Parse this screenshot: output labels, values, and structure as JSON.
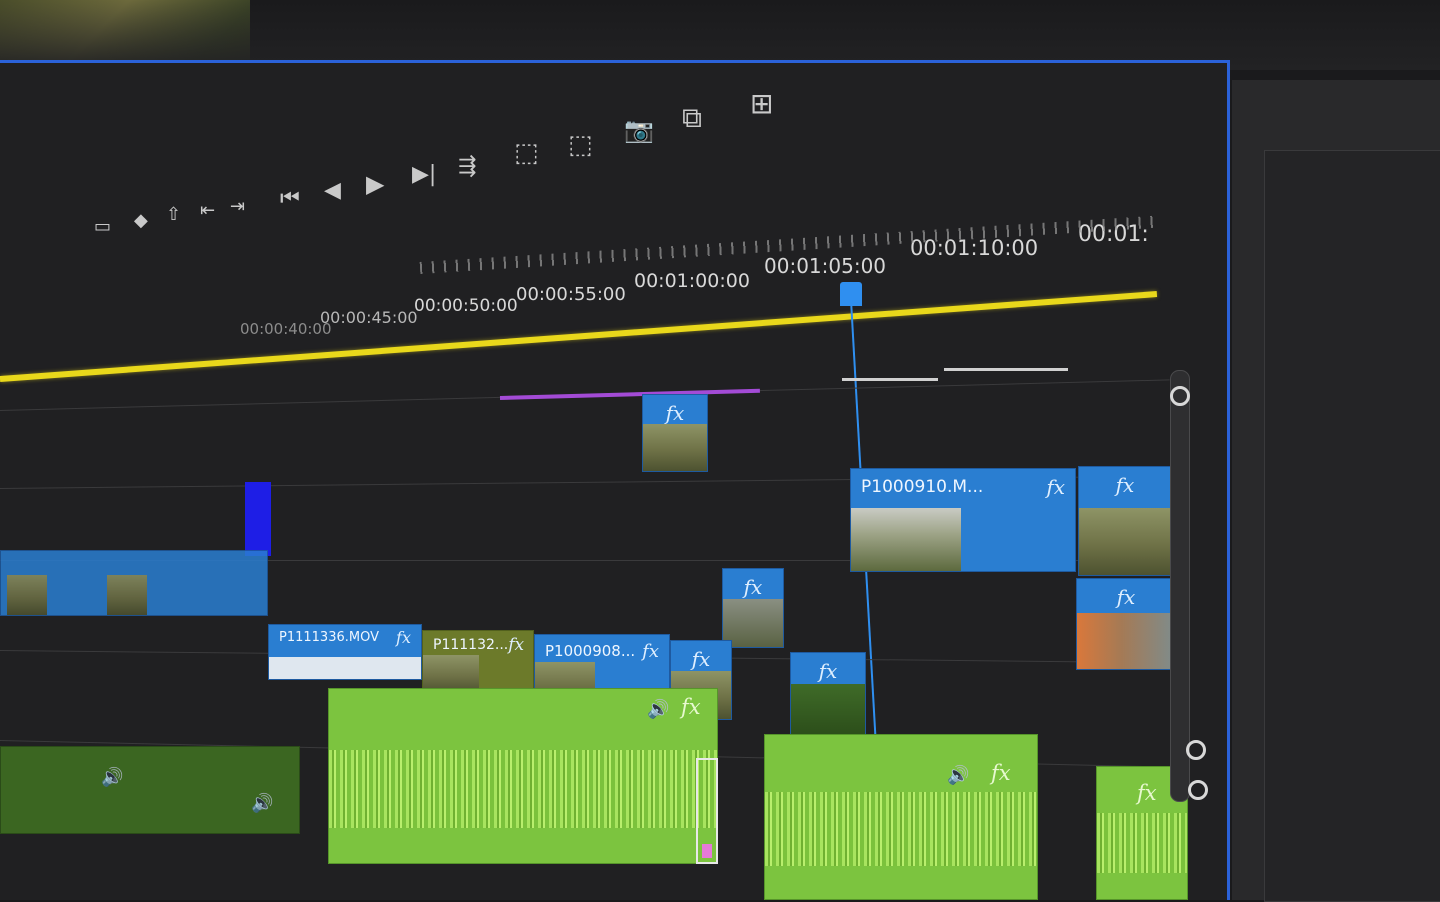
{
  "toolbar": {
    "buttons": [
      {
        "name": "mark-in-button",
        "glyph": "▭"
      },
      {
        "name": "mark-out-button",
        "glyph": "◆"
      },
      {
        "name": "lift-button",
        "glyph": "⇧"
      },
      {
        "name": "go-to-in-button",
        "glyph": "⇤"
      },
      {
        "name": "go-to-out-button",
        "glyph": "⇥"
      },
      {
        "name": "step-back-button",
        "glyph": "⏮"
      },
      {
        "name": "step-back-frame-button",
        "glyph": "◀"
      },
      {
        "name": "play-button",
        "glyph": "▶"
      },
      {
        "name": "step-forward-button",
        "glyph": "▶|"
      },
      {
        "name": "go-to-next-edit-button",
        "glyph": "⇶"
      },
      {
        "name": "lift-segment-button",
        "glyph": "⬚"
      },
      {
        "name": "extract-button",
        "glyph": "⬚"
      },
      {
        "name": "export-frame-button",
        "glyph": "📷"
      },
      {
        "name": "comparison-view-button",
        "glyph": "⧉"
      },
      {
        "name": "button-editor-button",
        "glyph": "⊞"
      }
    ]
  },
  "ruler": {
    "timecodes": [
      "00:00:45:00",
      "00:00:50:00",
      "00:00:55:00",
      "00:01:00:00",
      "00:01:05:00",
      "00:01:10:00",
      "00:01:"
    ],
    "dim_timecodes": [
      "00:00:40:00"
    ]
  },
  "clips": {
    "v3_small_fx": {
      "label": "",
      "fx": "fx"
    },
    "v2_p1000910": {
      "label": "P1000910.M...",
      "fx": "fx"
    },
    "v2_right": {
      "label": "",
      "fx": "fx"
    },
    "v1_mid": {
      "label": "",
      "fx": "fx"
    },
    "v1_right": {
      "label": "",
      "fx": "fx"
    },
    "v1_p1111336": {
      "label": "P1111336.MOV",
      "fx": "fx"
    },
    "v1_p111132": {
      "label": "P111132...",
      "fx": "fx"
    },
    "v1_p1000908": {
      "label": "P1000908...",
      "fx": "fx"
    },
    "v1_after": {
      "label": "",
      "fx": "fx"
    },
    "v1_green": {
      "label": "",
      "fx": "fx"
    }
  },
  "audio": {
    "a1": {
      "fx": "fx"
    },
    "a2": {
      "fx": "fx"
    },
    "a3": {
      "fx": "fx"
    }
  },
  "colors": {
    "panel_border": "#2b62d9",
    "work_area": "#e9d81b",
    "playhead": "#2f8ff0",
    "video_clip": "#2a7ed1",
    "audio_clip": "#7cc43f",
    "in_marker": "#1e1ee6"
  }
}
